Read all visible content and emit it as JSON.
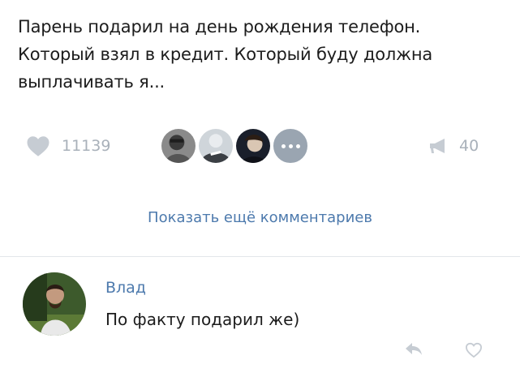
{
  "post": {
    "text_lines": [
      "Парень подарил на день рождения телефон.",
      "Который взял в кредит. Который буду должна",
      "выплачивать я..."
    ]
  },
  "actions": {
    "likes_count": "11139",
    "likes_icon": "heart-icon",
    "shares_count": "40",
    "shares_icon": "megaphone-icon",
    "likers_icon": "avatar",
    "more_likers_icon": "ellipsis-icon"
  },
  "comments": {
    "show_more_label": "Показать ещё   комментариев"
  },
  "comment": {
    "author": "Влад",
    "text": "По факту подарил же)",
    "reply_icon": "reply-icon",
    "like_icon": "heart-icon"
  },
  "colors": {
    "link": "#4d7aad",
    "muted": "#a9b1ba",
    "text": "#1c1c1c",
    "divider": "#e2e6ea"
  }
}
